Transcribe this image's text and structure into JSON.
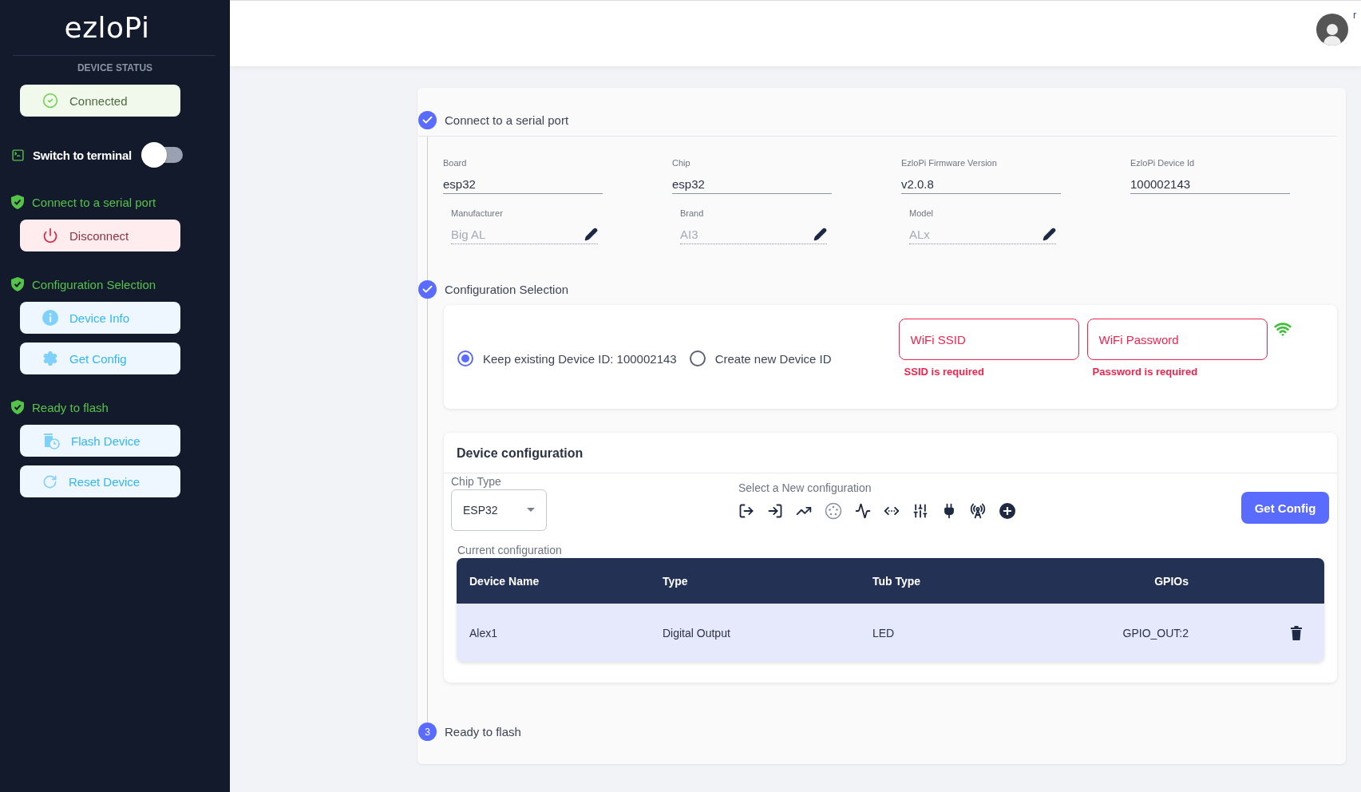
{
  "sidebar": {
    "logo": "ezloPi",
    "section_title": "DEVICE STATUS",
    "status": {
      "label": "Connected",
      "kind": "connected"
    },
    "terminal_switch": {
      "label": "Switch to terminal",
      "on": false
    },
    "steps": [
      {
        "title": "Connect to a serial port",
        "done": true,
        "buttons": [
          {
            "label": "Disconnect",
            "kind": "disconnect"
          }
        ]
      },
      {
        "title": "Configuration Selection",
        "done": true,
        "buttons": [
          {
            "label": "Device Info",
            "kind": "device-info"
          },
          {
            "label": "Get Config",
            "kind": "get-config"
          }
        ]
      },
      {
        "title": "Ready to flash",
        "done": true,
        "buttons": [
          {
            "label": "Flash Device",
            "kind": "flash"
          },
          {
            "label": "Reset Device",
            "kind": "reset"
          }
        ]
      }
    ]
  },
  "header": {
    "user_label": "r"
  },
  "steps": [
    {
      "label": "Connect to a serial port",
      "done": true
    },
    {
      "label": "Configuration Selection",
      "done": true
    },
    {
      "label": "Ready to flash",
      "done": false,
      "number": "3"
    }
  ],
  "device_info": {
    "fields": [
      {
        "label": "Board",
        "value": "esp32",
        "editable": false
      },
      {
        "label": "Chip",
        "value": "esp32",
        "editable": false
      },
      {
        "label": "EzloPi Firmware Version",
        "value": "v2.0.8",
        "editable": false
      },
      {
        "label": "EzloPi Device Id",
        "value": "100002143",
        "editable": false
      },
      {
        "label": "Manufacturer",
        "placeholder": "Big AL",
        "editable": true
      },
      {
        "label": "Brand",
        "placeholder": "AI3",
        "editable": true
      },
      {
        "label": "Model",
        "placeholder": "ALx",
        "editable": true
      }
    ]
  },
  "configuration_selection": {
    "options": [
      {
        "label": "Keep existing Device ID: 100002143",
        "selected": true
      },
      {
        "label": "Create new Device ID",
        "selected": false
      }
    ],
    "wifi_fields": [
      {
        "placeholder": "WiFi SSID",
        "error": "SSID is required"
      },
      {
        "placeholder": "WiFi Password",
        "error": "Password is required"
      }
    ]
  },
  "device_configuration": {
    "title": "Device configuration",
    "chip_type": {
      "label": "Chip Type",
      "value": "ESP32"
    },
    "new_config_label": "Select a New configuration",
    "get_config_button": "Get Config",
    "current_label": "Current configuration",
    "table": {
      "columns": [
        "Device Name",
        "Type",
        "Tub Type",
        "GPIOs"
      ],
      "rows": [
        {
          "cells": [
            "Alex1",
            "Digital Output",
            "LED",
            "GPIO_OUT:2"
          ]
        }
      ]
    }
  }
}
